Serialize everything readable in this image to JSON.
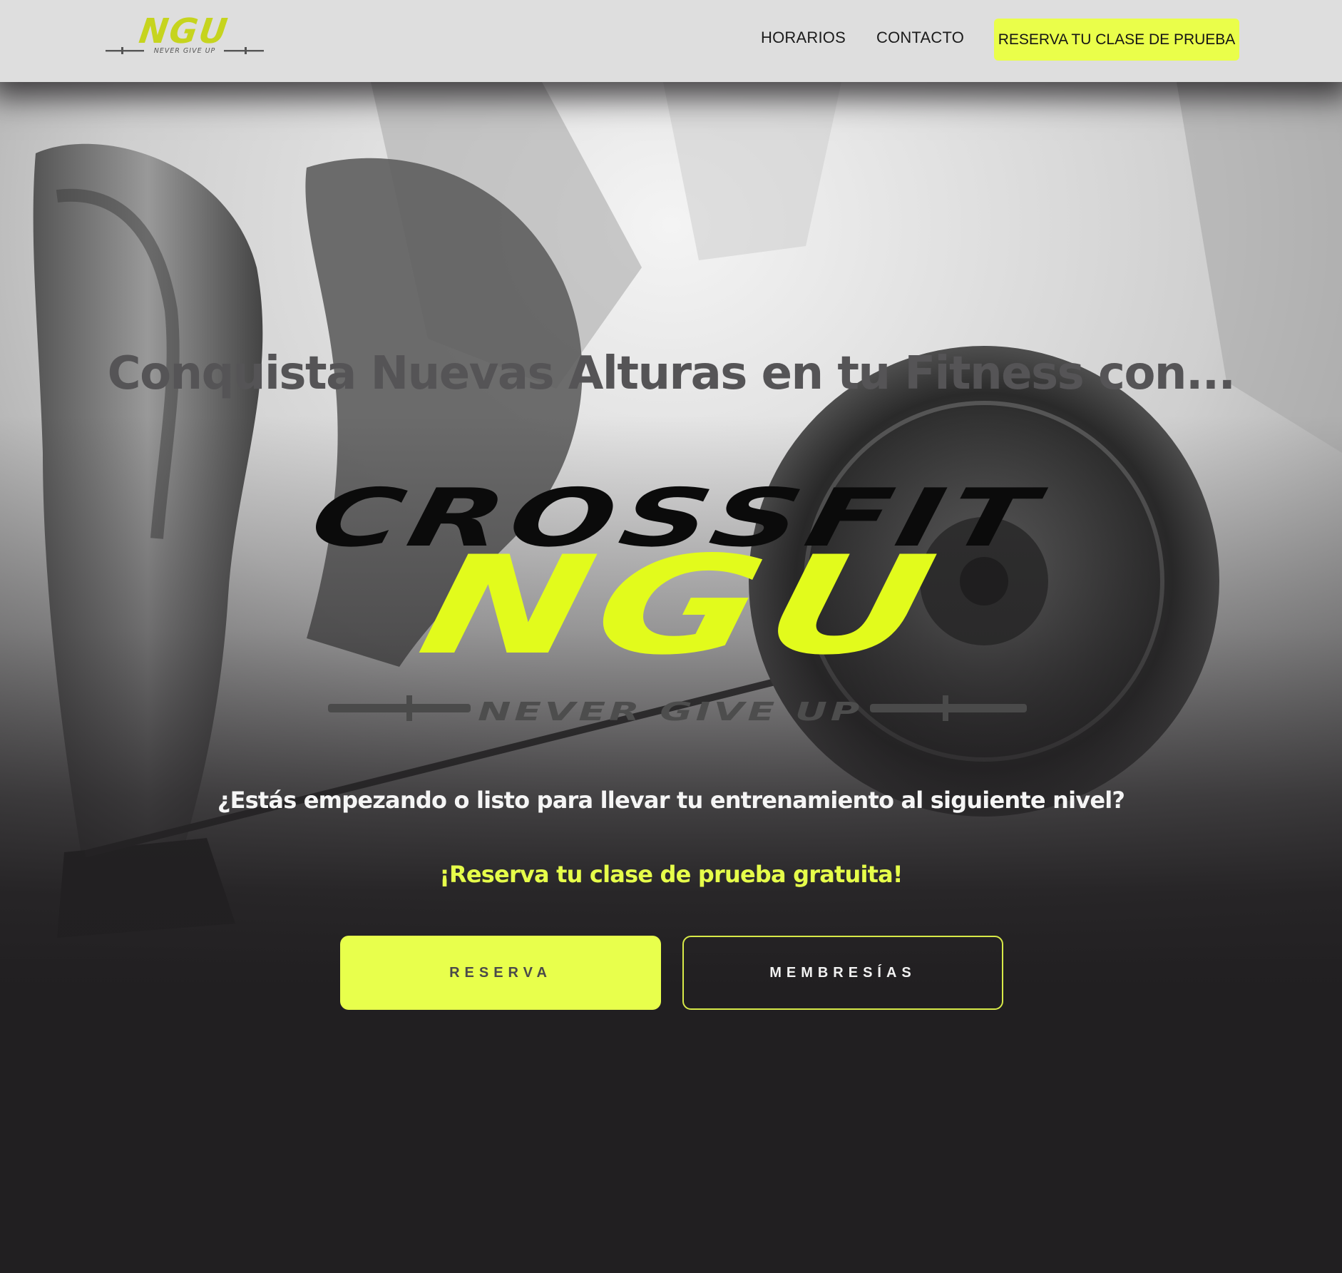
{
  "header": {
    "logo": {
      "text": "NGU",
      "tagline": "NEVER GIVE UP"
    },
    "nav": [
      {
        "label": "HORARIOS"
      },
      {
        "label": "CONTACTO"
      }
    ],
    "cta_label": "RESERVA TU CLASE DE PRUEBA"
  },
  "hero": {
    "title": "Conquista Nuevas Alturas en tu Fitness con...",
    "logo": {
      "line1": "CROSSFIT",
      "line2": "NGU",
      "tagline": "NEVER GIVE UP"
    },
    "question": "¿Estás empezando o listo para llevar tu entrenamiento al siguiente nivel?",
    "offer": "¡Reserva tu clase de prueba gratuita!",
    "buttons": {
      "primary_label": "RESERVA",
      "secondary_label": "MEMBRESÍAS"
    }
  },
  "colors": {
    "accent": "#e8ff4c",
    "header_bg": "#dedede",
    "page_bg": "#211f21",
    "title_gray": "#555456"
  },
  "icons": {
    "barbell": "barbell-icon"
  }
}
